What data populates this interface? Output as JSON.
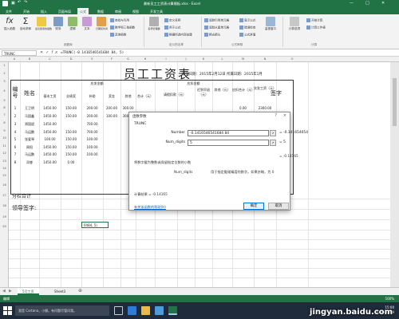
{
  "app": {
    "window_title": "最新员工工资表计算模板.xlsx - Excel",
    "title_account": "登录"
  },
  "ribbon": {
    "tabs": [
      "文件",
      "开始",
      "插入",
      "页面布局",
      "公式",
      "数据",
      "审阅",
      "视图",
      "开发工具"
    ],
    "active_tab": "公式",
    "buttons": [
      {
        "label": "插入函数"
      },
      {
        "label": "自动求和"
      },
      {
        "label": "最近使用的函数"
      },
      {
        "label": "财务"
      },
      {
        "label": "逻辑"
      },
      {
        "label": "文本"
      },
      {
        "label": "日期和时间"
      },
      {
        "label": "查找与引用"
      },
      {
        "label": "数学和三角函数"
      },
      {
        "label": "其他函数"
      },
      {
        "label": "名称管理器"
      }
    ],
    "small_buttons": [
      "定义名称",
      "用于公式",
      "根据所选内容创建",
      "追踪引用单元格",
      "追踪从属单元格",
      "移去箭头",
      "显示公式",
      "错误检查",
      "公式求值",
      "监视窗口",
      "计算选项",
      "开始计算",
      "计算工作表"
    ],
    "group_labels": [
      "函数库",
      "定义的名称",
      "公式审核",
      "计算"
    ]
  },
  "formula_bar": {
    "name_box": "TRUNC",
    "formula": "=TRUNC(-0.1416546541684 84, 5)"
  },
  "columns": [
    "A",
    "B",
    "C",
    "D",
    "E",
    "F",
    "G",
    "H",
    "I",
    "J",
    "K",
    "L",
    "M",
    "N",
    "O"
  ],
  "rows": [
    "1",
    "2",
    "3",
    "4",
    "5",
    "6",
    "7",
    "8",
    "9",
    "10",
    "11",
    "12",
    "13",
    "14",
    "15",
    "16",
    "17",
    "18",
    "19",
    "20"
  ],
  "sheet": {
    "title": "员工工资表",
    "date_line": "发放日期：2015年2月12日 所属日期：2015年1月",
    "headers": {
      "no": "编号",
      "name": "姓名",
      "payable": "应发金额",
      "base": "基本工资",
      "position": "业绩奖",
      "allowance": "补助",
      "attendance": "奖金",
      "bonus": "其他",
      "subtotal": "合计（元）",
      "deduct": "应扣金额",
      "leave": "请假扣款（元）",
      "late": "迟到早退（元）",
      "other_deduct": "其他（元）",
      "deduct_total": "应扣合计（元）",
      "actual": "实发工资（元）",
      "sign": "签字"
    },
    "employees": [
      {
        "no": "1",
        "name": "王卫明",
        "base": "1450.00",
        "position": "150.00",
        "allowance": "200.00",
        "bonus": "200.00",
        "subtotal": "300.00",
        "deduct_total": "0.00",
        "actual": "2300.00"
      },
      {
        "no": "2",
        "name": "马国鑫",
        "base": "1450.00",
        "position": "150.00",
        "allowance": "200.00",
        "bonus": "100.00",
        "subtotal": "300.00",
        "deduct_total": "0.00",
        "actual": "2200.00"
      },
      {
        "no": "3",
        "name": "郑国斌",
        "base": "1450.00",
        "position": "",
        "allowance": "700.00",
        "bonus": "",
        "subtotal": "",
        "deduct_total": "",
        "actual": ""
      },
      {
        "no": "4",
        "name": "马运鹏",
        "base": "1450.00",
        "position": "150.00",
        "allowance": "700.00",
        "bonus": "",
        "subtotal": "",
        "deduct_total": "",
        "actual": ""
      },
      {
        "no": "5",
        "name": "张爱琴",
        "base": "100.00",
        "position": "150.00",
        "allowance": "100.00",
        "bonus": "",
        "subtotal": "",
        "deduct_total": "",
        "actual": ""
      },
      {
        "no": "6",
        "name": "周阳",
        "base": "1450.00",
        "position": "150.00",
        "allowance": "100.00",
        "bonus": "",
        "subtotal": "",
        "deduct_total": "",
        "actual": ""
      },
      {
        "no": "7",
        "name": "马运鹏",
        "base": "1450.00",
        "position": "150.00",
        "allowance": "100.00",
        "bonus": "",
        "subtotal": "",
        "deduct_total": "",
        "actual": ""
      },
      {
        "no": "8",
        "name": "邓睿",
        "base": "1450.00",
        "position": "0.00",
        "allowance": "",
        "bonus": "",
        "subtotal": "",
        "deduct_total": "",
        "actual": ""
      }
    ],
    "subtotal_row": "分栏合计",
    "leader_sign": "领导签字:",
    "active_cell_text": "0484, 5)"
  },
  "dialog": {
    "title": "函数参数",
    "help": "?",
    "close": "×",
    "function_name": "TRUNC",
    "args": [
      {
        "label": "Number",
        "value": "-0.1416546541684 84",
        "result": "= -0.141654654"
      },
      {
        "label": "Num_digits",
        "value": "5",
        "result": "= 5"
      }
    ],
    "total_result": "= -0.14165",
    "description": "将数字截为整数或保留指定位数的小数",
    "arg_help_label": "Num_digits",
    "arg_help": "用于指定截尾精度的数字。如果忽略，为 0",
    "calc_result": "计算结果 = -0.14165",
    "help_link": "有关该函数的帮助(H)",
    "ok": "确定",
    "cancel": "取消"
  },
  "sheet_tabs": [
    "5月工资",
    "Sheet3"
  ],
  "status": {
    "mode": "编辑",
    "zoom": "100%"
  },
  "taskbar": {
    "search": "我是 Cortana，小娜。有问题尽管问我。",
    "time": "15:00",
    "date": "2016-03-09",
    "watermark": "jingyan.baidu.com"
  },
  "colors": {
    "excel_green": "#217346",
    "taskbar": "#1f2b3b"
  }
}
